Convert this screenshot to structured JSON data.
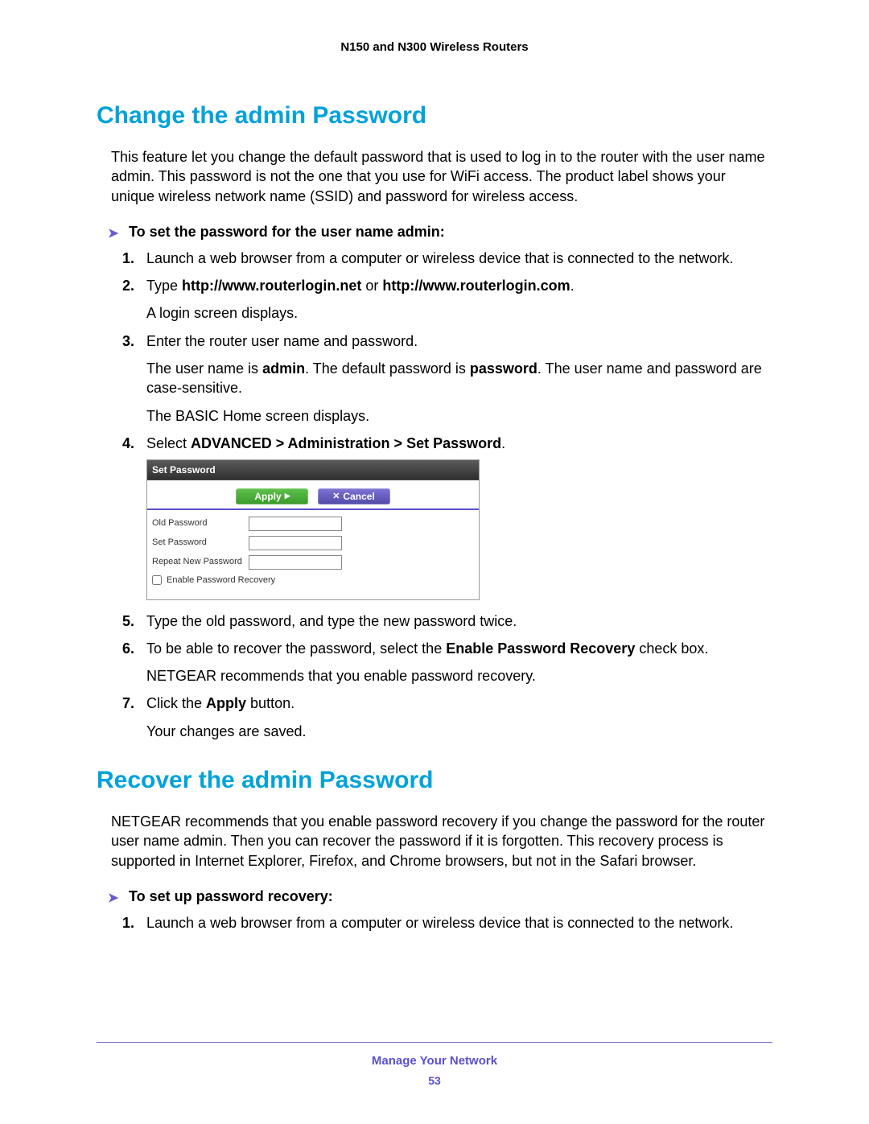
{
  "doc_header": "N150 and N300 Wireless Routers",
  "section1": {
    "title": "Change the admin Password",
    "intro": "This feature let you change the default password that is used to log in to the router with the user name admin. This password is not the one that you use for WiFi access. The product label shows your unique wireless network name (SSID) and password for wireless access.",
    "proc_heading": "To set the password for the user name admin:",
    "steps": {
      "s1": "Launch a web browser from a computer or wireless device that is connected to the network.",
      "s2_pre": "Type ",
      "s2_b1": "http://www.routerlogin.net",
      "s2_mid": " or ",
      "s2_b2": "http://www.routerlogin.com",
      "s2_post": ".",
      "s2_p": "A login screen displays.",
      "s3": "Enter the router user name and password.",
      "s3_p1a": "The user name is ",
      "s3_p1b": "admin",
      "s3_p1c": ". The default password is ",
      "s3_p1d": "password",
      "s3_p1e": ". The user name and password are case-sensitive.",
      "s3_p2": "The BASIC Home screen displays.",
      "s4_pre": "Select ",
      "s4_b": "ADVANCED > Administration > Set Password",
      "s4_post": ".",
      "s5": "Type the old password, and type the new password twice.",
      "s6_pre": "To be able to recover the password, select the ",
      "s6_b": "Enable Password Recovery",
      "s6_post": " check box.",
      "s6_p": "NETGEAR recommends that you enable password recovery.",
      "s7_pre": "Click the ",
      "s7_b": "Apply",
      "s7_post": " button.",
      "s7_p": "Your changes are saved."
    },
    "panel": {
      "title": "Set Password",
      "apply": "Apply",
      "cancel": "Cancel",
      "old_label": "Old Password",
      "set_label": "Set Password",
      "repeat_label": "Repeat New Password",
      "enable_label": "Enable Password Recovery"
    }
  },
  "section2": {
    "title": "Recover the admin Password",
    "intro": "NETGEAR recommends that you enable password recovery if you change the password for the router user name admin. Then you can recover the password if it is forgotten. This recovery process is supported in Internet Explorer, Firefox, and Chrome browsers, but not in the Safari browser.",
    "proc_heading": "To set up password recovery:",
    "steps": {
      "s1": "Launch a web browser from a computer or wireless device that is connected to the network."
    }
  },
  "footer": {
    "chapter": "Manage Your Network",
    "page": "53"
  }
}
